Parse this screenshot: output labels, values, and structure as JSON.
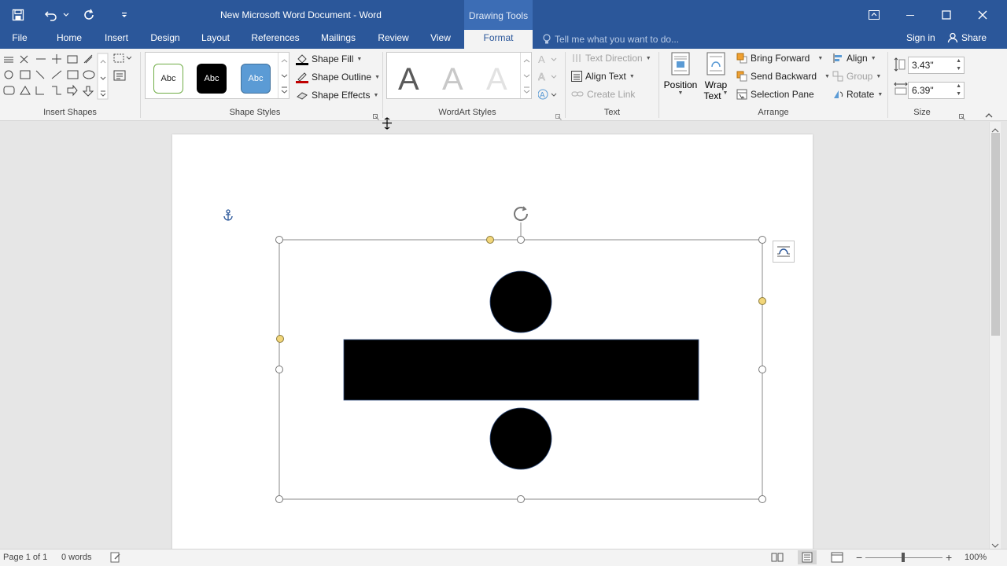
{
  "window": {
    "title": "New Microsoft Word Document - Word",
    "context_tab_label": "Drawing Tools"
  },
  "tabs": [
    {
      "label": "File"
    },
    {
      "label": "Home"
    },
    {
      "label": "Insert"
    },
    {
      "label": "Design"
    },
    {
      "label": "Layout"
    },
    {
      "label": "References"
    },
    {
      "label": "Mailings"
    },
    {
      "label": "Review"
    },
    {
      "label": "View"
    },
    {
      "label": "Format",
      "active": true
    }
  ],
  "tell_me_placeholder": "Tell me what you want to do...",
  "sign_in": "Sign in",
  "share": "Share",
  "ribbon": {
    "insert_shapes_label": "Insert Shapes",
    "shape_styles": {
      "label": "Shape Styles",
      "presets": [
        "Abc",
        "Abc",
        "Abc"
      ],
      "shape_fill": "Shape Fill",
      "shape_outline": "Shape Outline",
      "shape_effects": "Shape Effects"
    },
    "wordart": {
      "label": "WordArt Styles",
      "letters": [
        "A",
        "A",
        "A"
      ]
    },
    "text": {
      "label": "Text",
      "text_direction": "Text Direction",
      "align_text": "Align Text",
      "create_link": "Create Link"
    },
    "arrange": {
      "label": "Arrange",
      "position": "Position",
      "wrap_text_line1": "Wrap",
      "wrap_text_line2": "Text",
      "bring_forward": "Bring Forward",
      "send_backward": "Send Backward",
      "selection_pane": "Selection Pane",
      "align": "Align",
      "group": "Group",
      "rotate": "Rotate"
    },
    "size": {
      "label": "Size",
      "height": "3.43\"",
      "width": "6.39\""
    }
  },
  "status": {
    "page": "Page 1 of 1",
    "words": "0 words",
    "zoom": "100%"
  },
  "colors": {
    "title_bar": "#2b579a",
    "context_tab": "#3c6db5",
    "shape_fill": "#000000",
    "accent_style": "#5b9bd5"
  }
}
